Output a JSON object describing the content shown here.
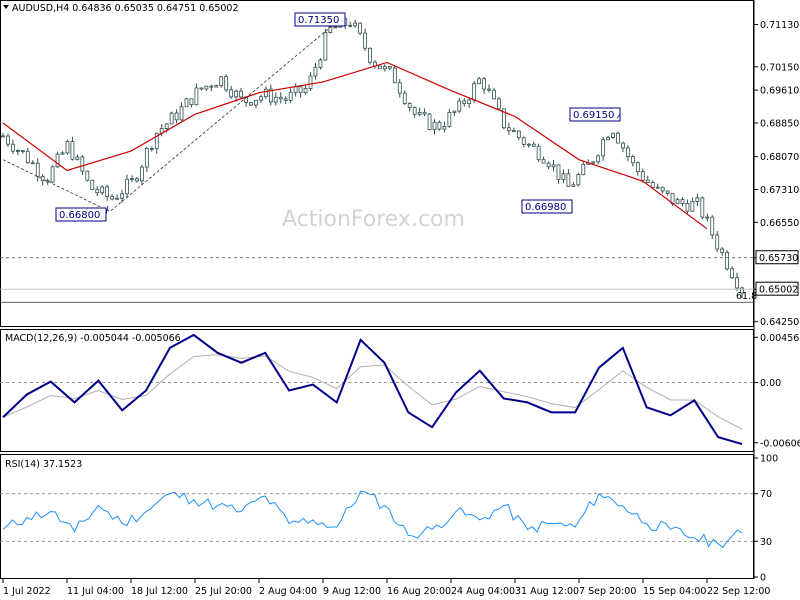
{
  "header": {
    "symbol_line": "AUDUSD,H4  0.64836 0.65035 0.64751 0.65002",
    "macd_line": "MACD(12,26,9) -0.005044 -0.005066",
    "rsi_line": "RSI(14) 37.1523",
    "watermark": "ActionForex.com"
  },
  "colors": {
    "candles": "#2f4f4f",
    "ma": "#cc0000",
    "macd": "#00008b",
    "signal": "#b0b0b0",
    "rsi": "#1e90ff",
    "label_border": "#000080"
  },
  "x_axis": {
    "labels": [
      "1 Jul 2022",
      "11 Jul 04:00",
      "18 Jul 12:00",
      "25 Jul 20:00",
      "2 Aug 04:00",
      "9 Aug 12:00",
      "16 Aug 20:00",
      "24 Aug 04:00",
      "31 Aug 12:00",
      "7 Sep 20:00",
      "15 Sep 04:00",
      "22 Sep 12:00"
    ]
  },
  "price_axis": {
    "ticks": [
      "0.71130",
      "0.70150",
      "0.69610",
      "0.68850",
      "0.68070",
      "0.67310",
      "0.66550",
      "0.65730",
      "0.65002",
      "0.64250"
    ],
    "levels": {
      "resistance": "0.65730",
      "current": "0.65002"
    },
    "fib_label": "61.8"
  },
  "annotations": [
    {
      "text": "0.71350"
    },
    {
      "text": "0.66800"
    },
    {
      "text": "0.66980"
    },
    {
      "text": "0.69150"
    }
  ],
  "macd_axis": {
    "ticks": [
      "0.004567",
      "0.00",
      "-0.006069"
    ]
  },
  "rsi_axis": {
    "ticks": [
      "100",
      "70",
      "30",
      "0"
    ]
  },
  "chart_data": {
    "type": "candlestick",
    "symbol": "AUDUSD",
    "timeframe": "H4",
    "ohlc_last": {
      "open": 0.64836,
      "high": 0.65035,
      "low": 0.64751,
      "close": 0.65002
    },
    "price_ylim": [
      0.6415,
      0.7165
    ],
    "close_path": [
      {
        "x": "1 Jul 2022",
        "y": 0.6855
      },
      {
        "x": "4 Jul",
        "y": 0.681
      },
      {
        "x": "7 Jul",
        "y": 0.6755
      },
      {
        "x": "9 Jul",
        "y": 0.6835
      },
      {
        "x": "11 Jul 04:00",
        "y": 0.6735
      },
      {
        "x": "14 Jul",
        "y": 0.671
      },
      {
        "x": "15 Jul",
        "y": 0.675
      },
      {
        "x": "18 Jul 12:00",
        "y": 0.686
      },
      {
        "x": "21 Jul",
        "y": 0.6905
      },
      {
        "x": "25 Jul 20:00",
        "y": 0.696
      },
      {
        "x": "28 Jul",
        "y": 0.699
      },
      {
        "x": "30 Jul",
        "y": 0.6935
      },
      {
        "x": "2 Aug 04:00",
        "y": 0.695
      },
      {
        "x": "4 Aug",
        "y": 0.694
      },
      {
        "x": "6 Aug",
        "y": 0.6965
      },
      {
        "x": "9 Aug 12:00",
        "y": 0.71
      },
      {
        "x": "11 Aug",
        "y": 0.712
      },
      {
        "x": "13 Aug",
        "y": 0.703
      },
      {
        "x": "16 Aug 20:00",
        "y": 0.699
      },
      {
        "x": "19 Aug",
        "y": 0.69
      },
      {
        "x": "22 Aug",
        "y": 0.6875
      },
      {
        "x": "24 Aug 04:00",
        "y": 0.692
      },
      {
        "x": "26 Aug",
        "y": 0.699
      },
      {
        "x": "29 Aug",
        "y": 0.6885
      },
      {
        "x": "31 Aug 12:00",
        "y": 0.684
      },
      {
        "x": "3 Sep",
        "y": 0.6805
      },
      {
        "x": "5 Sep",
        "y": 0.6735
      },
      {
        "x": "7 Sep 20:00",
        "y": 0.679
      },
      {
        "x": "9 Sep",
        "y": 0.688
      },
      {
        "x": "12 Sep",
        "y": 0.6785
      },
      {
        "x": "15 Sep 04:00",
        "y": 0.673
      },
      {
        "x": "17 Sep",
        "y": 0.67
      },
      {
        "x": "20 Sep",
        "y": 0.6695
      },
      {
        "x": "22 Sep 12:00",
        "y": 0.659
      },
      {
        "x": "24 Sep",
        "y": 0.65
      }
    ],
    "moving_average": [
      {
        "x": "1 Jul 2022",
        "y": 0.6885
      },
      {
        "x": "11 Jul 04:00",
        "y": 0.6775
      },
      {
        "x": "18 Jul 12:00",
        "y": 0.682
      },
      {
        "x": "25 Jul 20:00",
        "y": 0.6905
      },
      {
        "x": "2 Aug 04:00",
        "y": 0.6955
      },
      {
        "x": "9 Aug 12:00",
        "y": 0.698
      },
      {
        "x": "16 Aug 20:00",
        "y": 0.7025
      },
      {
        "x": "24 Aug 04:00",
        "y": 0.696
      },
      {
        "x": "31 Aug 12:00",
        "y": 0.69
      },
      {
        "x": "7 Sep 20:00",
        "y": 0.68
      },
      {
        "x": "15 Sep 04:00",
        "y": 0.675
      },
      {
        "x": "22 Sep 12:00",
        "y": 0.664
      }
    ],
    "zigzag": [
      {
        "x": "1 Jul 2022",
        "y": 0.68
      },
      {
        "x": "13 Jul",
        "y": 0.668
      },
      {
        "x": "11 Aug",
        "y": 0.7135
      }
    ],
    "horizontal_levels": [
      0.6573,
      0.65002,
      0.647
    ],
    "macd": {
      "ylim": [
        -0.0068,
        0.0052
      ],
      "values": [
        -0.0035,
        -0.0012,
        0.0001,
        -0.002,
        0.0002,
        -0.0028,
        -0.0008,
        0.0035,
        0.0048,
        0.003,
        0.002,
        0.003,
        -0.0008,
        -0.0002,
        -0.002,
        0.0043,
        0.002,
        -0.003,
        -0.0045,
        -0.001,
        0.0012,
        -0.0016,
        -0.002,
        -0.003,
        -0.003,
        0.0015,
        0.0035,
        -0.0025,
        -0.0033,
        -0.0018,
        -0.0055,
        -0.0062
      ]
    },
    "rsi": {
      "ylim": [
        0,
        100
      ],
      "levels": [
        70,
        30
      ],
      "values": [
        40,
        50,
        55,
        38,
        60,
        45,
        55,
        70,
        65,
        60,
        55,
        68,
        45,
        48,
        42,
        72,
        60,
        35,
        40,
        55,
        48,
        60,
        40,
        45,
        42,
        70,
        60,
        45,
        40,
        33,
        28,
        37
      ]
    }
  }
}
